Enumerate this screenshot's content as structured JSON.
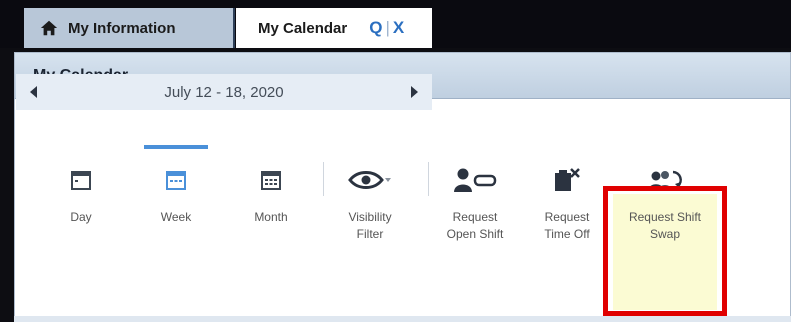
{
  "tabs": {
    "info_label": "My Information",
    "calendar_label": "My Calendar",
    "calendar_tools": {
      "search_glyph": "Q",
      "separator": "|",
      "close_glyph": "X"
    },
    "info_icon": "home-icon"
  },
  "panel": {
    "title": "My Calendar"
  },
  "date_nav": {
    "label": "July 12 - 18, 2020"
  },
  "toolbar": {
    "day": "Day",
    "week": "Week",
    "month": "Month",
    "visibility_line1": "Visibility",
    "visibility_line2": "Filter",
    "open_shift_line1": "Request",
    "open_shift_line2": "Open Shift",
    "time_off_line1": "Request",
    "time_off_line2": "Time Off",
    "swap_line1": "Request Shift",
    "swap_line2": "Swap",
    "active_view": "Week"
  },
  "colors": {
    "accent": "#4a90d9",
    "highlight_border": "#e00000",
    "swap_highlight_bg": "#fbfbd3",
    "tab_active": "#ffffff",
    "tab_inactive": "#b8c7d8"
  }
}
